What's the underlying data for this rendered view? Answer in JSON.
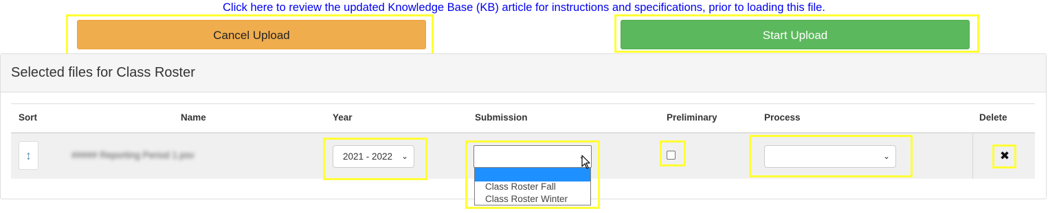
{
  "kb_link": {
    "text": "Click here to review the updated Knowledge Base (KB) article for instructions and specifications, prior to loading this file."
  },
  "buttons": {
    "cancel_label": "Cancel Upload",
    "start_label": "Start Upload"
  },
  "panel": {
    "title": "Selected files for Class Roster"
  },
  "table": {
    "headers": {
      "sort": "Sort",
      "name": "Name",
      "year": "Year",
      "submission": "Submission",
      "preliminary": "Preliminary",
      "process": "Process",
      "delete": "Delete"
    },
    "rows": [
      {
        "name": "##### Reporting Period 1.psv",
        "year": "2021 - 2022",
        "submission": "",
        "preliminary": false,
        "process": ""
      }
    ]
  },
  "submission_dropdown": {
    "options": [
      "",
      "Class Roster Fall",
      "Class Roster Winter"
    ],
    "highlighted_index": 0
  },
  "icons": {
    "sort": "sort-vertical-arrow-icon",
    "delete": "close-x-icon",
    "caret": "chevron-down-icon"
  },
  "colors": {
    "highlight": "#ffff33",
    "cancel": "#f0ad4e",
    "start": "#5cb85c",
    "link": "#0000ee",
    "dropdown_selected": "#1e90ff"
  }
}
